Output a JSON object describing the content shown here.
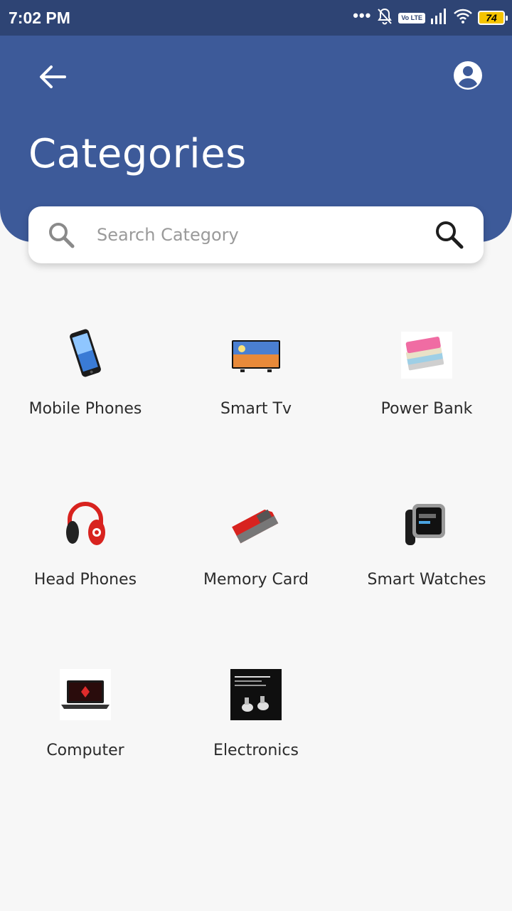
{
  "status_bar": {
    "time": "7:02 PM",
    "dots": "•••",
    "volte": "Vo LTE",
    "battery": "74"
  },
  "header": {
    "title": "Categories",
    "back_icon": "arrow-left-icon",
    "profile_icon": "account-circle-icon",
    "background_color": "#3d5a99"
  },
  "search": {
    "placeholder": "Search Category",
    "value": ""
  },
  "categories": [
    {
      "label": "Mobile Phones",
      "icon": "mobile-phone-image"
    },
    {
      "label": "Smart Tv",
      "icon": "smart-tv-image"
    },
    {
      "label": "Power Bank",
      "icon": "power-bank-image"
    },
    {
      "label": "Head Phones",
      "icon": "headphones-image"
    },
    {
      "label": "Memory Card",
      "icon": "memory-card-image"
    },
    {
      "label": "Smart Watches",
      "icon": "smart-watch-image"
    },
    {
      "label": "Computer",
      "icon": "laptop-image"
    },
    {
      "label": "Electronics",
      "icon": "electronics-image"
    }
  ]
}
